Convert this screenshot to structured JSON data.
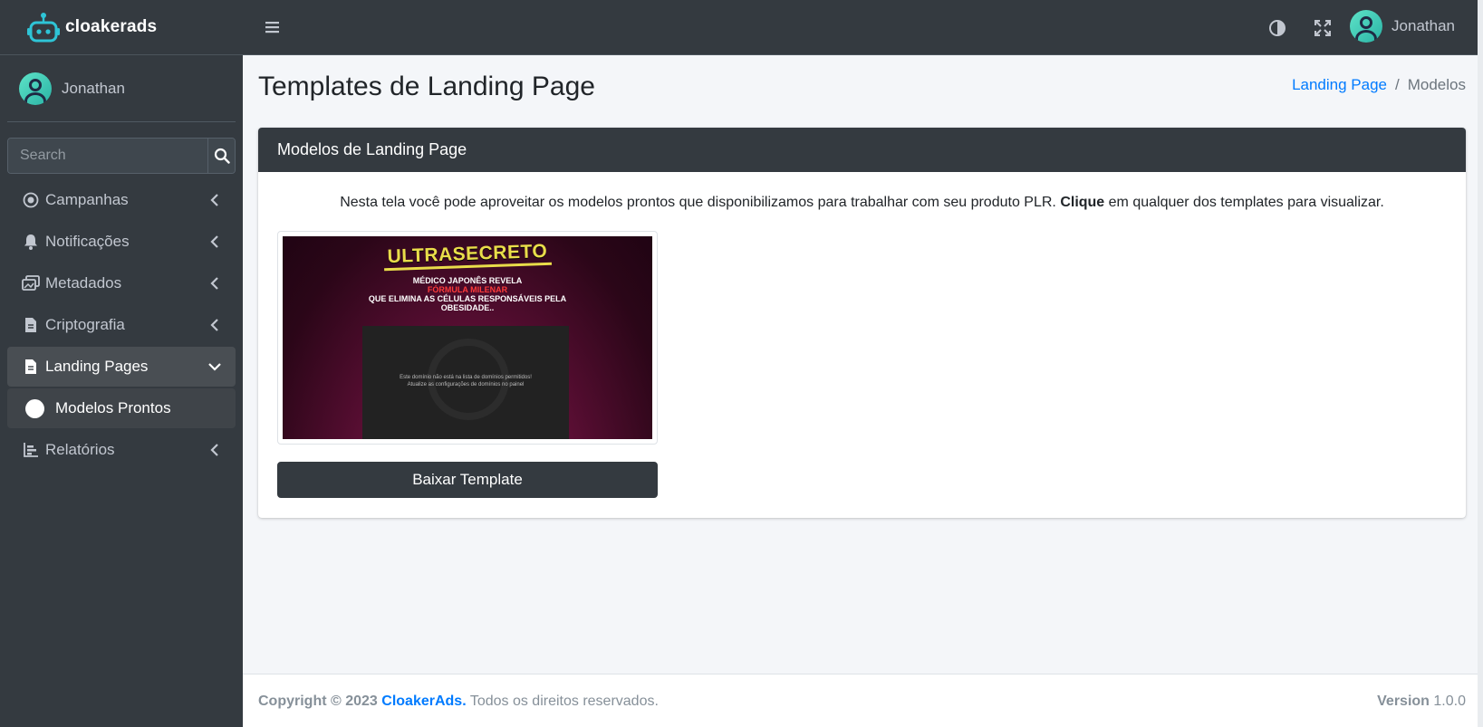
{
  "brand": {
    "name": "cloakerads"
  },
  "sidebar": {
    "user_name": "Jonathan",
    "search": {
      "placeholder": "Search",
      "value": ""
    },
    "items": [
      {
        "label": "Campanhas",
        "icon": "circle-dot-icon"
      },
      {
        "label": "Notificações",
        "icon": "bell-icon"
      },
      {
        "label": "Metadados",
        "icon": "images-icon"
      },
      {
        "label": "Criptografia",
        "icon": "file-icon"
      },
      {
        "label": "Landing Pages",
        "icon": "file-text-icon",
        "expanded": true
      },
      {
        "label": "Modelos Prontos",
        "icon": "circle-icon",
        "sub": true,
        "active": true
      },
      {
        "label": "Relatórios",
        "icon": "chart-icon"
      }
    ]
  },
  "topbar": {
    "user_name": "Jonathan",
    "icons": [
      "menu-icon",
      "contrast-icon",
      "fullscreen-icon"
    ]
  },
  "header": {
    "title": "Templates de Landing Page",
    "breadcrumb": {
      "link": "Landing Page",
      "separator": "/",
      "current": "Modelos"
    }
  },
  "card": {
    "title": "Modelos de Landing Page",
    "description_pre": "Nesta tela você pode aproveitar os modelos prontos que disponibilizamos para trabalhar com seu produto PLR. ",
    "description_bold": "Clique",
    "description_post": " em qualquer dos templates para visualizar.",
    "template": {
      "logo_text": "ULTRASECRETO",
      "line1": "MÉDICO JAPONÊS REVELA",
      "line2": "FÓRMULA MILENAR",
      "line3": "QUE ELIMINA AS CÉLULAS RESPONSÁVEIS PELA",
      "line4": "OBESIDADE..",
      "video_msg1": "Este domínio não está na lista de domínios permitidos!",
      "video_msg2": "Atualize as configurações de domínios no painel"
    },
    "download_label": "Baixar Template"
  },
  "footer": {
    "copyright": "Copyright © 2023",
    "brand": "CloakerAds.",
    "rights": "Todos os direitos reservados.",
    "version_label": "Version",
    "version": "1.0.0"
  },
  "colors": {
    "sidebar_bg": "#343a40",
    "accent": "#007bff",
    "content_bg": "#f4f6f9"
  }
}
